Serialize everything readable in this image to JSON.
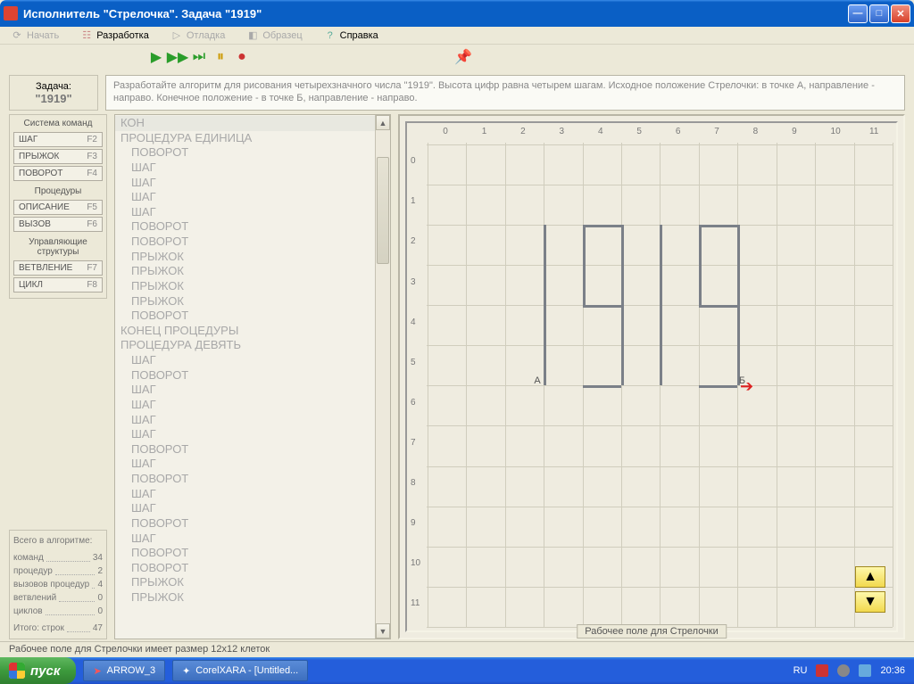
{
  "titlebar": {
    "title": "Исполнитель \"Стрелочка\".   Задача  \"1919\""
  },
  "menubar": {
    "start": "Начать",
    "dev": "Разработка",
    "debug": "Отладка",
    "sample": "Образец",
    "help": "Справка"
  },
  "task": {
    "label": "Задача:",
    "number": "\"1919\"",
    "desc": "Разработайте алгоритм для рисования четырехзначного числа \"1919\". Высота цифр равна четырем шагам. Исходное положение Стрелочки: в точке А, направление - направо. Конечное положение - в  точке Б, направление - направо."
  },
  "panels": {
    "commands_title": "Система команд",
    "procedures_title": "Процедуры",
    "controls_title": "Управляющие структуры",
    "commands": [
      {
        "label": "ШАГ",
        "key": "F2"
      },
      {
        "label": "ПРЫЖОК",
        "key": "F3"
      },
      {
        "label": "ПОВОРОТ",
        "key": "F4"
      }
    ],
    "procedures": [
      {
        "label": "ОПИСАНИЕ",
        "key": "F5"
      },
      {
        "label": "ВЫЗОВ",
        "key": "F6"
      }
    ],
    "controls": [
      {
        "label": "ВЕТВЛЕНИЕ",
        "key": "F7"
      },
      {
        "label": "ЦИКЛ",
        "key": "F8"
      }
    ]
  },
  "stats": {
    "title": "Всего в алгоритме:",
    "rows": [
      {
        "label": "команд",
        "value": "34"
      },
      {
        "label": "процедур",
        "value": "2"
      },
      {
        "label": "вызовов процедур",
        "value": "4"
      },
      {
        "label": "ветвлений",
        "value": "0"
      },
      {
        "label": "циклов",
        "value": "0"
      }
    ],
    "total_label": "Итого:  строк",
    "total_value": "47"
  },
  "code": [
    {
      "t": "КОН",
      "sel": true
    },
    {
      "t": "ПРОЦЕДУРА ЕДИНИЦА"
    },
    {
      "t": "ПОВОРОТ",
      "i": 1
    },
    {
      "t": "ШАГ",
      "i": 1
    },
    {
      "t": "ШАГ",
      "i": 1
    },
    {
      "t": "ШАГ",
      "i": 1
    },
    {
      "t": "ШАГ",
      "i": 1
    },
    {
      "t": "ПОВОРОТ",
      "i": 1
    },
    {
      "t": "ПОВОРОТ",
      "i": 1
    },
    {
      "t": "ПРЫЖОК",
      "i": 1
    },
    {
      "t": "ПРЫЖОК",
      "i": 1
    },
    {
      "t": "ПРЫЖОК",
      "i": 1
    },
    {
      "t": "ПРЫЖОК",
      "i": 1
    },
    {
      "t": "ПОВОРОТ",
      "i": 1
    },
    {
      "t": "КОНЕЦ ПРОЦЕДУРЫ"
    },
    {
      "t": "ПРОЦЕДУРА ДЕВЯТЬ"
    },
    {
      "t": "ШАГ",
      "i": 1
    },
    {
      "t": "ПОВОРОТ",
      "i": 1
    },
    {
      "t": "ШАГ",
      "i": 1
    },
    {
      "t": "ШАГ",
      "i": 1
    },
    {
      "t": "ШАГ",
      "i": 1
    },
    {
      "t": "ШАГ",
      "i": 1
    },
    {
      "t": "ПОВОРОТ",
      "i": 1
    },
    {
      "t": "ШАГ",
      "i": 1
    },
    {
      "t": "ПОВОРОТ",
      "i": 1
    },
    {
      "t": "ШАГ",
      "i": 1
    },
    {
      "t": "ШАГ",
      "i": 1
    },
    {
      "t": "ПОВОРОТ",
      "i": 1
    },
    {
      "t": "ШАГ",
      "i": 1
    },
    {
      "t": "ПОВОРОТ",
      "i": 1
    },
    {
      "t": "ПОВОРОТ",
      "i": 1
    },
    {
      "t": "ПРЫЖОК",
      "i": 1
    },
    {
      "t": "ПРЫЖОК",
      "i": 1
    }
  ],
  "field": {
    "caption": "Рабочее поле для Стрелочки",
    "pointA": "А",
    "pointB": "Б"
  },
  "statusbar": "Рабочее поле для Стрелочки имеет размер 12x12 клеток",
  "taskbar": {
    "start": "пуск",
    "apps": [
      "ARROW_3",
      "CorelXARA - [Untitled..."
    ],
    "lang": "RU",
    "clock": "20:36"
  }
}
